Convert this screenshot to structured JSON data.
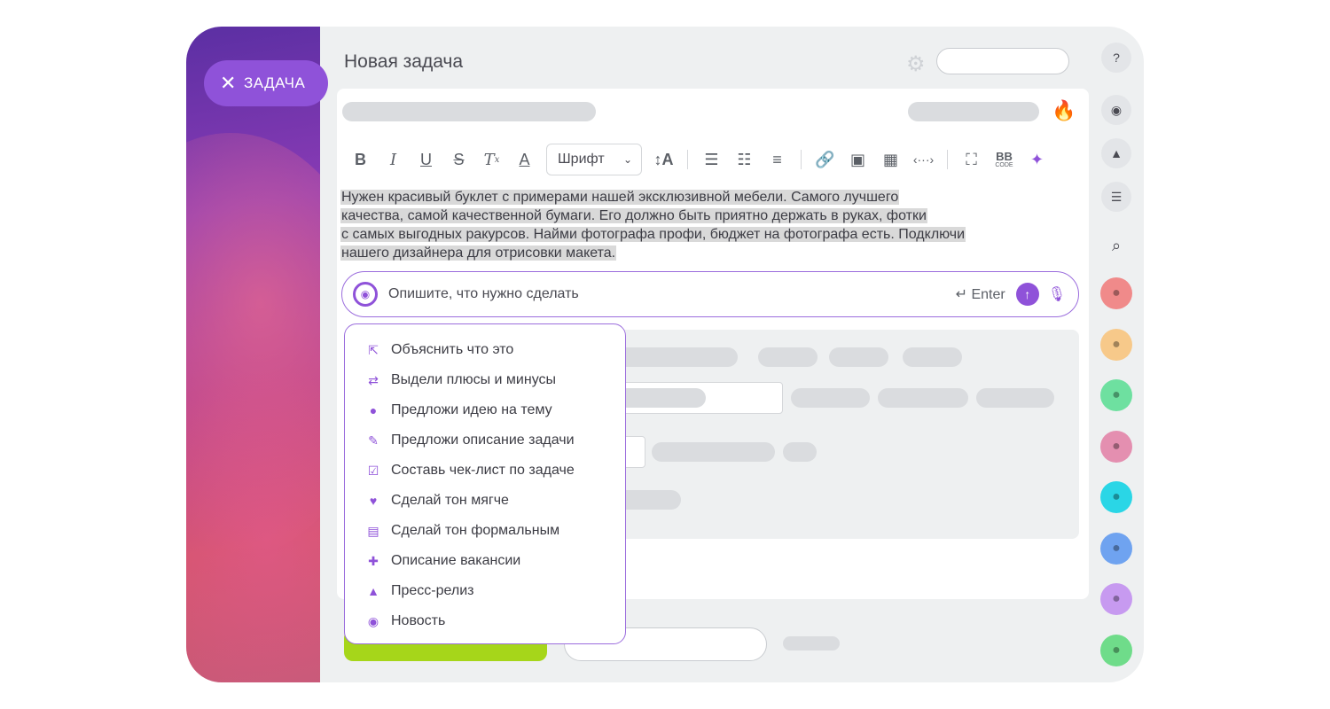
{
  "header": {
    "close_label": "ЗАДАЧА",
    "title": "Новая задача"
  },
  "toolbar": {
    "font_select": "Шрифт",
    "bbcode_top": "BB",
    "bbcode_bottom": "CODE"
  },
  "editor": {
    "lines": [
      "Нужен красивый буклет с примерами нашей эксклюзивной мебели. Самого лучшего",
      "качества, самой качественной бумаги. Его должно быть приятно держать в руках, фотки",
      "с самых выгодных ракурсов. Найми фотографа профи, бюджет на фотографа есть. Подключи",
      "нашего дизайнера для отрисовки макета."
    ]
  },
  "ai_input": {
    "placeholder": "Опишите, что нужно сделать",
    "enter_hint": "↵ Enter"
  },
  "menu": {
    "items": [
      {
        "label": "Объяснить что это",
        "icon": "pointer-click-icon"
      },
      {
        "label": "Выдели плюсы и минусы",
        "icon": "swap-arrows-icon"
      },
      {
        "label": "Предложи идею на тему",
        "icon": "lightbulb-icon"
      },
      {
        "label": "Предложи описание задачи",
        "icon": "pencil-icon"
      },
      {
        "label": "Составь чек-лист по задаче",
        "icon": "checklist-icon"
      },
      {
        "label": "Сделай тон мягче",
        "icon": "heart-icon"
      },
      {
        "label": "Сделай тон формальным",
        "icon": "briefcase-icon"
      },
      {
        "label": "Описание вакансии",
        "icon": "user-plus-icon"
      },
      {
        "label": "Пресс-релиз",
        "icon": "bell-icon"
      },
      {
        "label": "Новость",
        "icon": "broadcast-icon"
      }
    ]
  },
  "colors": {
    "accent": "#8f52d9",
    "green_button": "#a6d61a",
    "avatars": [
      "#f08a8a",
      "#f7c98a",
      "#6ee0a0",
      "#e48fb0",
      "#2ad6e6",
      "#6fa3f0",
      "#c79af0",
      "#6fdc8a"
    ]
  }
}
